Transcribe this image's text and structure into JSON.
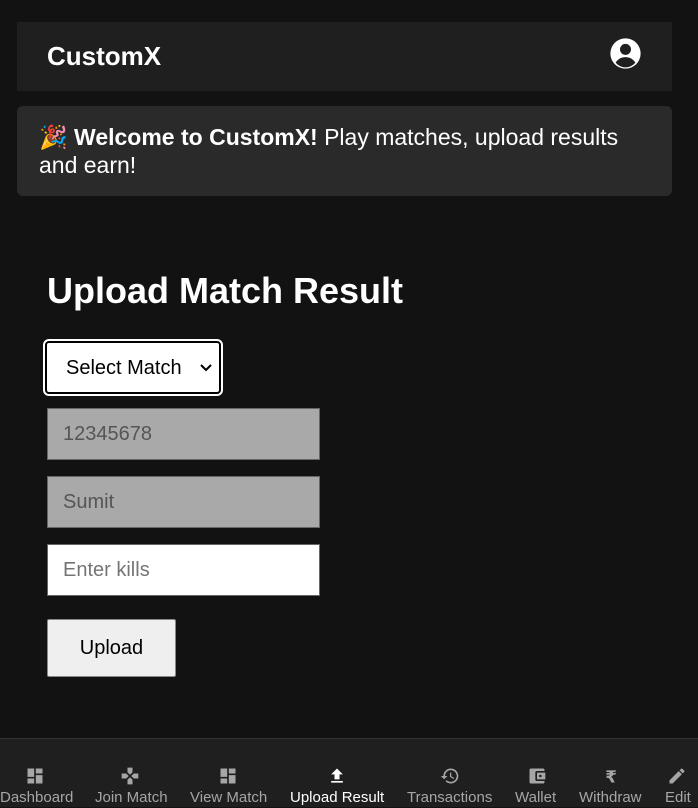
{
  "header": {
    "brand": "CustomX",
    "profile_icon": "account-circle-icon"
  },
  "welcome": {
    "emoji": "🎉",
    "bold": "Welcome to CustomX!",
    "text": " Play matches, upload results and earn!"
  },
  "form": {
    "title": "Upload Match Result",
    "select_match": {
      "selected": "Select Match",
      "options": [
        "Select Match"
      ]
    },
    "uid_value": "12345678",
    "name_value": "Sumit",
    "kills_placeholder": "Enter kills",
    "upload_label": "Upload"
  },
  "nav": {
    "active": "Upload Result",
    "items": [
      {
        "label": "Dashboard",
        "icon": "dashboard-icon"
      },
      {
        "label": "Join Match",
        "icon": "gamepad-icon"
      },
      {
        "label": "View Match",
        "icon": "dashboard-icon"
      },
      {
        "label": "Upload Result",
        "icon": "upload-icon"
      },
      {
        "label": "Transactions",
        "icon": "history-icon"
      },
      {
        "label": "Wallet",
        "icon": "wallet-icon"
      },
      {
        "label": "Withdraw",
        "icon": "rupee-icon"
      },
      {
        "label": "Edit",
        "icon": "pencil-icon"
      }
    ]
  },
  "colors": {
    "background": "#121212",
    "header": "#1f1f1f",
    "banner": "#2a2a2a",
    "nav_inactive": "#a6a6a6",
    "nav_active": "#ffffff"
  }
}
